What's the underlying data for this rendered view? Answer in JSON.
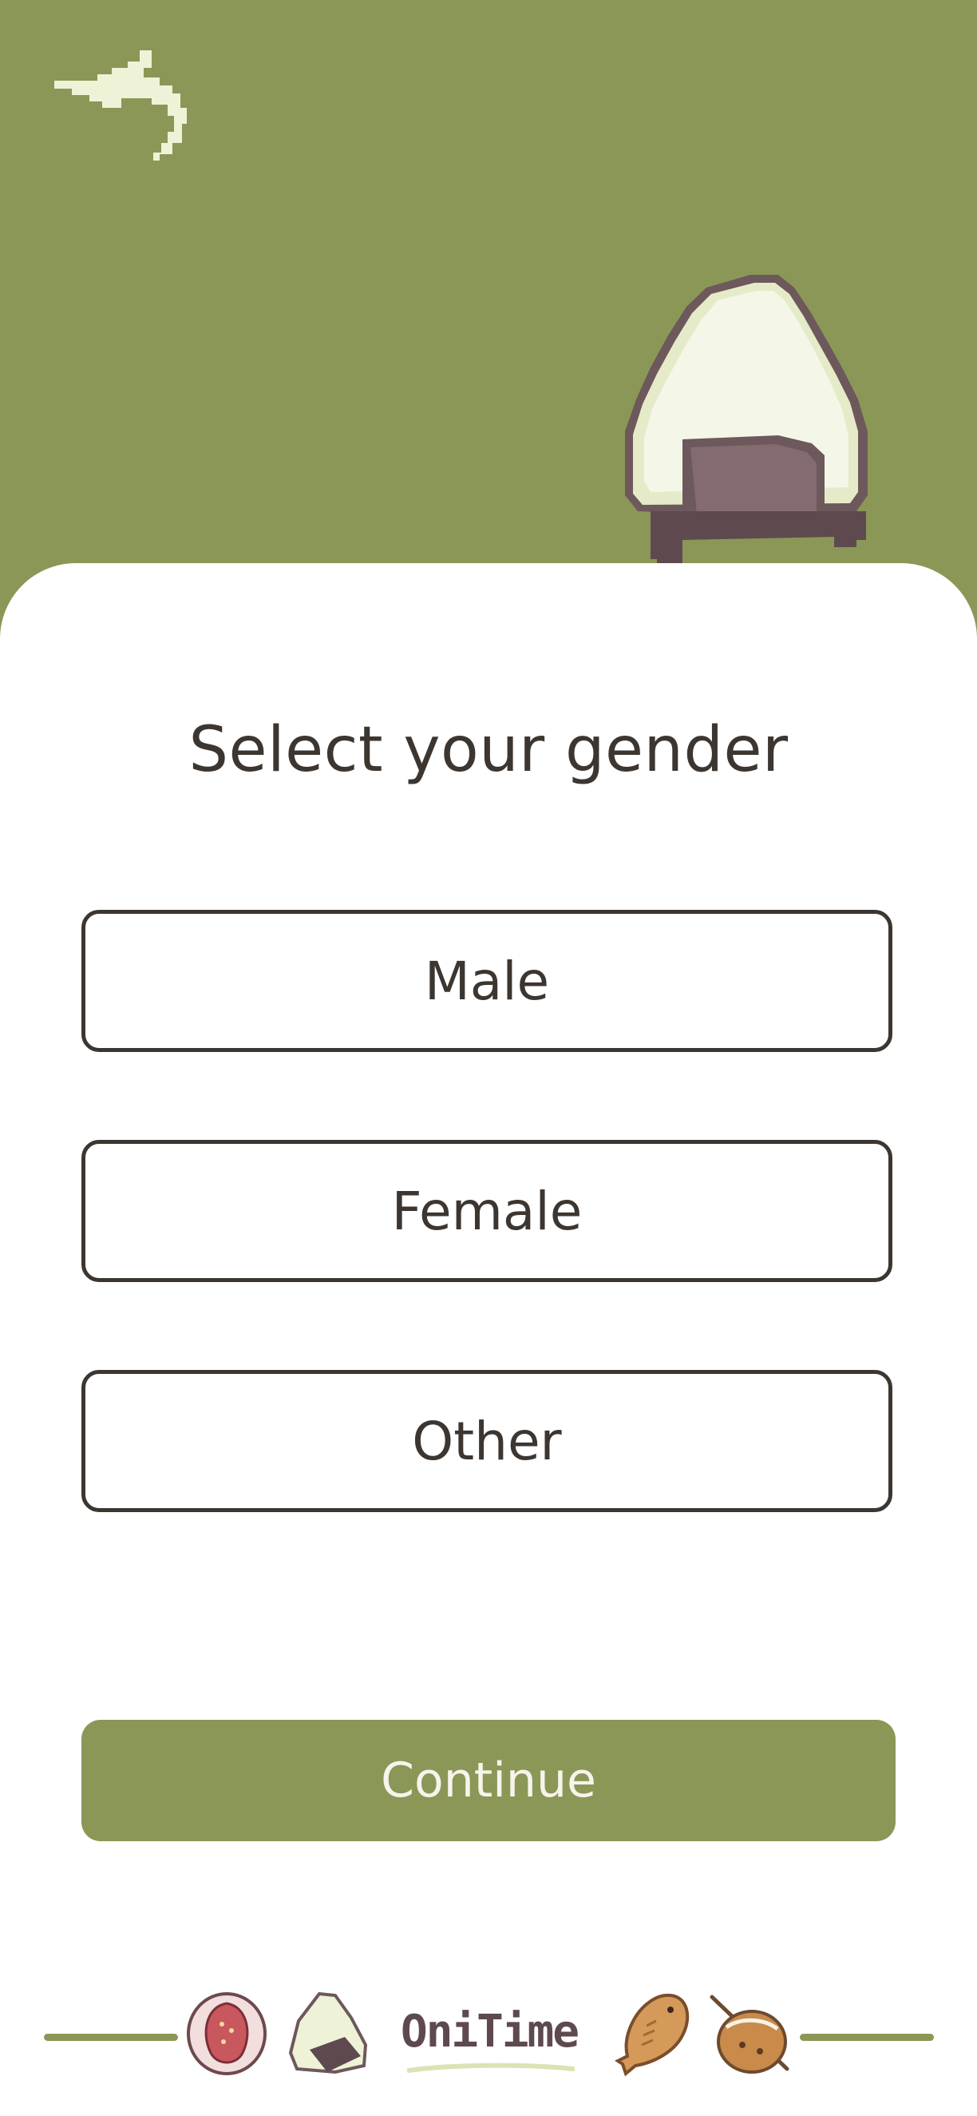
{
  "header": {
    "back_icon": "arrow-back-icon",
    "mascot_icon": "onigiri-icon",
    "background_color": "#8b9756"
  },
  "main": {
    "title": "Select your gender",
    "options": [
      {
        "label": "Male"
      },
      {
        "label": "Female"
      },
      {
        "label": "Other"
      }
    ],
    "continue_label": "Continue",
    "accent_color": "#8b9756",
    "text_color": "#3d3630"
  },
  "footer": {
    "brand": "OniTime",
    "icons": [
      "strawberry-daifuku-icon",
      "onigiri-icon",
      "taiyaki-icon",
      "takoyaki-icon"
    ]
  }
}
